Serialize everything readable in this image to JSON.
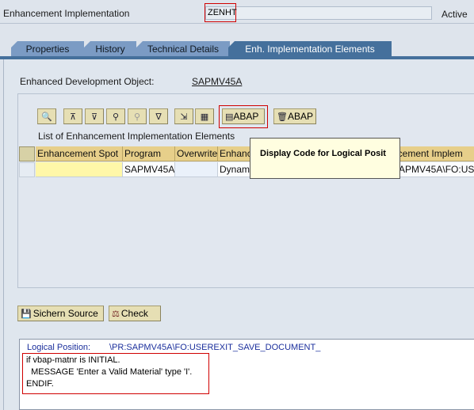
{
  "header": {
    "label": "Enhancement Implementation",
    "value": "ZENHT",
    "status": "Active"
  },
  "tabs": [
    {
      "label": "Properties",
      "active": false
    },
    {
      "label": "History",
      "active": false
    },
    {
      "label": "Technical Details",
      "active": false
    },
    {
      "label": "Enh. Implementation Elements",
      "active": true
    }
  ],
  "object": {
    "label": "Enhanced Development Object:",
    "value": "SAPMV45A"
  },
  "toolbar": {
    "buttons": [
      {
        "name": "details-icon",
        "glyph": "🔍"
      },
      {
        "name": "sort-ascending-icon",
        "glyph": "⊼"
      },
      {
        "name": "sort-descending-icon",
        "glyph": "⊽"
      },
      {
        "name": "find-icon",
        "glyph": "⚲"
      },
      {
        "name": "find-next-icon",
        "glyph": "⚲"
      },
      {
        "name": "filter-icon",
        "glyph": "∇"
      },
      {
        "name": "export-icon",
        "glyph": "⇲"
      },
      {
        "name": "layout-grid-icon",
        "glyph": "▦"
      }
    ],
    "display_abap_label": "ABAP",
    "delete_abap_label": "ABAP"
  },
  "list": {
    "title": "List of Enhancement Implementation Elements",
    "columns": [
      "Enhancement Spot",
      "Program",
      "Overwrite",
      "Enhanc",
      "",
      "ncement Implem"
    ],
    "row": [
      "",
      "SAPMV45A",
      "",
      "Dynam",
      "",
      "SAPMV45A\\FO:US"
    ]
  },
  "tooltip": "Display Code for Logical Posit",
  "source_buttons": {
    "save_label": "Sichern Source",
    "check_label": "Check"
  },
  "editor": {
    "position_label": "Logical Position:",
    "position_value": "\\PR:SAPMV45A\\FO:USEREXIT_SAVE_DOCUMENT_",
    "lines": [
      "if vbap-matnr is INITIAL.",
      "  MESSAGE 'Enter a Valid Material' type 'I'.",
      "ENDIF."
    ]
  },
  "colors": {
    "highlight_red": "#d00000",
    "active_tab": "#45709c",
    "table_header": "#e7cf8a",
    "tooltip_bg": "#fffee0"
  }
}
